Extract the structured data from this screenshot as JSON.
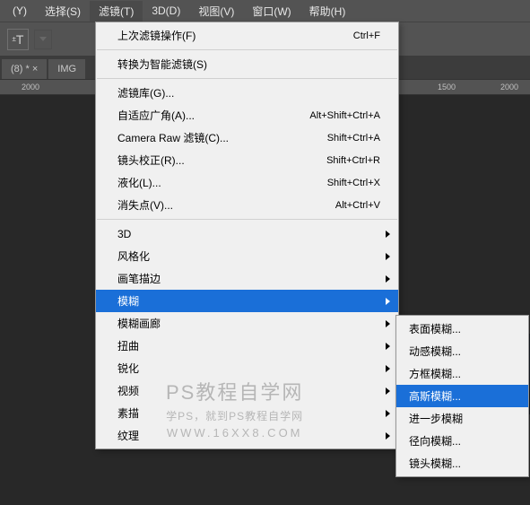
{
  "menubar": {
    "items": [
      {
        "label": "(Y)"
      },
      {
        "label": "选择(S)"
      },
      {
        "label": "滤镜(T)"
      },
      {
        "label": "3D(D)"
      },
      {
        "label": "视图(V)"
      },
      {
        "label": "窗口(W)"
      },
      {
        "label": "帮助(H)"
      }
    ]
  },
  "toolbar": {
    "tool_label": "T"
  },
  "tabs": {
    "t0": {
      "label": "(8) *  ×"
    },
    "t1": {
      "label": "IMG"
    }
  },
  "ruler": {
    "m0": "2000",
    "m1": "1500",
    "m2": "2000"
  },
  "filter_menu": {
    "last_filter": {
      "label": "上次滤镜操作(F)",
      "shortcut": "Ctrl+F"
    },
    "convert_smart": {
      "label": "转换为智能滤镜(S)"
    },
    "gallery": {
      "label": "滤镜库(G)..."
    },
    "adaptive_wide": {
      "label": "自适应广角(A)...",
      "shortcut": "Alt+Shift+Ctrl+A"
    },
    "camera_raw": {
      "label": "Camera Raw 滤镜(C)...",
      "shortcut": "Shift+Ctrl+A"
    },
    "lens_correction": {
      "label": "镜头校正(R)...",
      "shortcut": "Shift+Ctrl+R"
    },
    "liquify": {
      "label": "液化(L)...",
      "shortcut": "Shift+Ctrl+X"
    },
    "vanishing_point": {
      "label": "消失点(V)...",
      "shortcut": "Alt+Ctrl+V"
    },
    "three_d": {
      "label": "3D"
    },
    "stylize": {
      "label": "风格化"
    },
    "brush_strokes": {
      "label": "画笔描边"
    },
    "blur": {
      "label": "模糊"
    },
    "blur_gallery": {
      "label": "模糊画廊"
    },
    "distort": {
      "label": "扭曲"
    },
    "sharpen": {
      "label": "锐化"
    },
    "video": {
      "label": "视频"
    },
    "sketch": {
      "label": "素描"
    },
    "texture": {
      "label": "纹理"
    }
  },
  "blur_submenu": {
    "surface": {
      "label": "表面模糊..."
    },
    "motion": {
      "label": "动感模糊..."
    },
    "box": {
      "label": "方框模糊..."
    },
    "gaussian": {
      "label": "高斯模糊..."
    },
    "more": {
      "label": "进一步模糊"
    },
    "radial": {
      "label": "径向模糊..."
    },
    "lens": {
      "label": "镜头模糊..."
    }
  },
  "watermark": {
    "line1": "PS教程自学网",
    "line2": "学PS，就到PS教程自学网",
    "line3": "WWW.16XX8.COM"
  }
}
